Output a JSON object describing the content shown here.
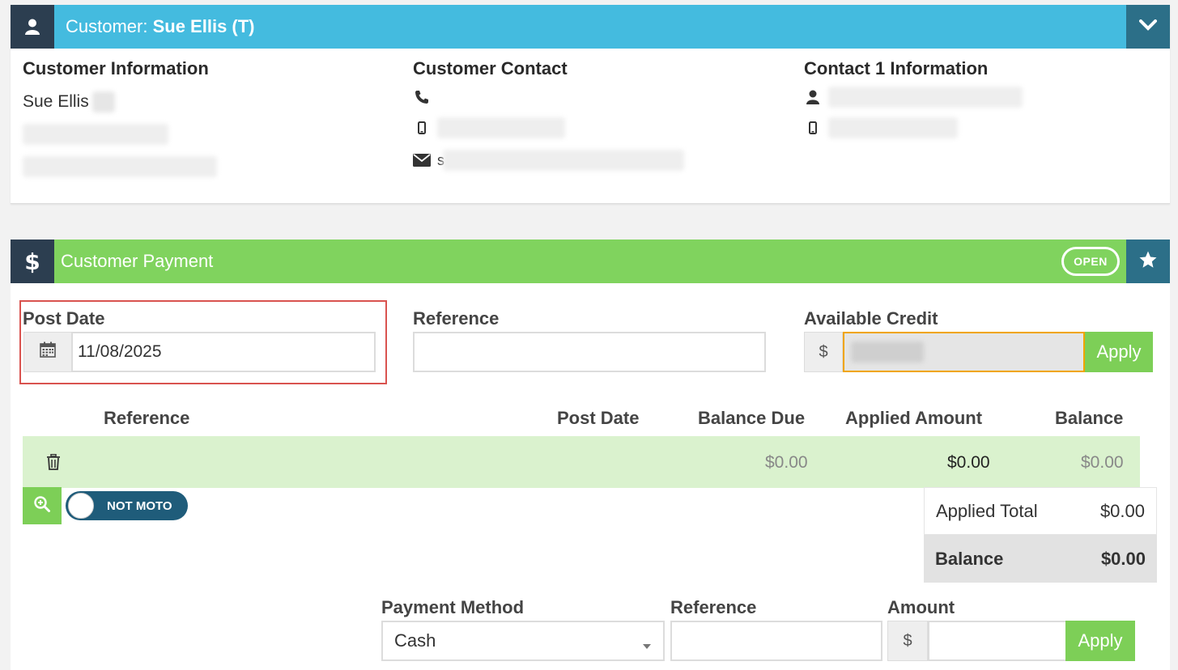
{
  "customer_panel": {
    "title_prefix": "Customer: ",
    "title_name": "Sue Ellis (T)",
    "icons": {
      "header": "user-icon",
      "toggle": "chevron-down-icon"
    },
    "info": {
      "heading": "Customer Information",
      "name": "Sue Ellis"
    },
    "contact": {
      "heading": "Customer Contact",
      "email_initial": "s"
    },
    "contact1": {
      "heading": "Contact 1 Information"
    }
  },
  "payment_panel": {
    "title": "Customer Payment",
    "status_badge": "OPEN",
    "icons": {
      "header": "dollar-icon",
      "favorite": "star-icon"
    },
    "post_date": {
      "label": "Post Date",
      "value": "11/08/2025"
    },
    "reference": {
      "label": "Reference",
      "value": ""
    },
    "available_credit": {
      "label": "Available Credit",
      "currency": "$",
      "apply_label": "Apply"
    },
    "table": {
      "headers": [
        "Reference",
        "Post Date",
        "Balance Due",
        "Applied Amount",
        "Balance"
      ],
      "rows": [
        {
          "reference": "",
          "post_date": "",
          "balance_due": "$0.00",
          "applied_amount": "$0.00",
          "balance": "$0.00"
        }
      ]
    },
    "moto_toggle": "NOT MOTO",
    "totals": {
      "applied_total_label": "Applied Total",
      "applied_total_value": "$0.00",
      "balance_label": "Balance",
      "balance_value": "$0.00"
    },
    "payment_method": {
      "label": "Payment Method",
      "selected": "Cash"
    },
    "payment_reference": {
      "label": "Reference",
      "value": ""
    },
    "amount": {
      "label": "Amount",
      "currency": "$",
      "apply_label": "Apply"
    }
  },
  "colors": {
    "customer_header": "#44bbdf",
    "payment_header": "#80d35e",
    "dark_accent": "#2c3e50",
    "teal_button": "#2c6f88",
    "highlight": "#d9534f",
    "focus_border": "#f0a500"
  }
}
